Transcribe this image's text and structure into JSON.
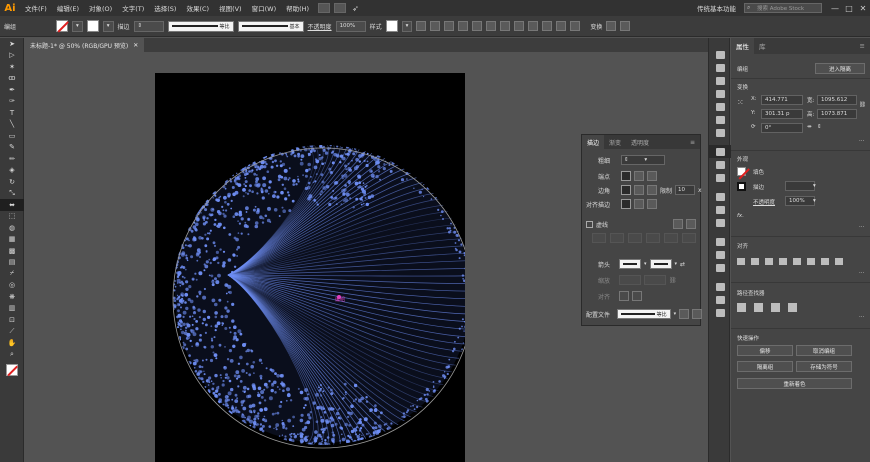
{
  "app": {
    "logo": "Ai"
  },
  "menu": [
    "文件(F)",
    "编辑(E)",
    "对象(O)",
    "文字(T)",
    "选择(S)",
    "效果(C)",
    "视图(V)",
    "窗口(W)",
    "帮助(H)"
  ],
  "workspace": "传统基本功能",
  "search": {
    "placeholder": "搜索 Adobe Stock"
  },
  "window_controls": [
    "—",
    "□",
    "✕"
  ],
  "control_bar": {
    "object_label": "编组",
    "stroke_label": "描边",
    "stroke_weight": "",
    "profile_label": "等比",
    "brush_label": "基本",
    "opacity_label": "不透明度",
    "opacity_value": "100%",
    "style_label": "样式",
    "transform_label": "变换"
  },
  "document": {
    "tab_title": "未标题-1* @ 50% (RGB/GPU 预览)"
  },
  "artwork": {
    "selection_label": "编组",
    "sphere_color": "#6f8ff5"
  },
  "stroke_panel": {
    "tabs": [
      "描边",
      "渐变",
      "透明度"
    ],
    "weight_label": "粗细",
    "cap_label": "端点",
    "corner_label": "边角",
    "limit_label": "限制",
    "limit_value": "10",
    "align_label": "对齐描边",
    "dashed_label": "虚线",
    "arrowhead_label": "箭头",
    "scale_label": "缩放",
    "align_arrow_label": "对齐",
    "profile_label": "配置文件",
    "profile_value": "等比"
  },
  "properties": {
    "tabs": [
      "属性",
      "库"
    ],
    "section_group": "编组",
    "isolate_button": "进入隔离",
    "section_transform": "变换",
    "x": "414.771",
    "y": "301.31 p",
    "w": "1095.612",
    "h": "1073.871",
    "angle": "0°",
    "section_appearance": "外观",
    "fill_label": "填色",
    "stroke_label": "描边",
    "opacity_label": "不透明度",
    "opacity_value": "100%",
    "fx": "fx.",
    "section_align": "对齐",
    "section_pathfinder": "路径查找器",
    "section_quick": "快速操作",
    "btn_offset": "偏移",
    "btn_ungroup": "取消编组",
    "btn_isolate": "隔离组",
    "btn_add_symbol": "存储为符号",
    "btn_recolor": "重新着色"
  }
}
